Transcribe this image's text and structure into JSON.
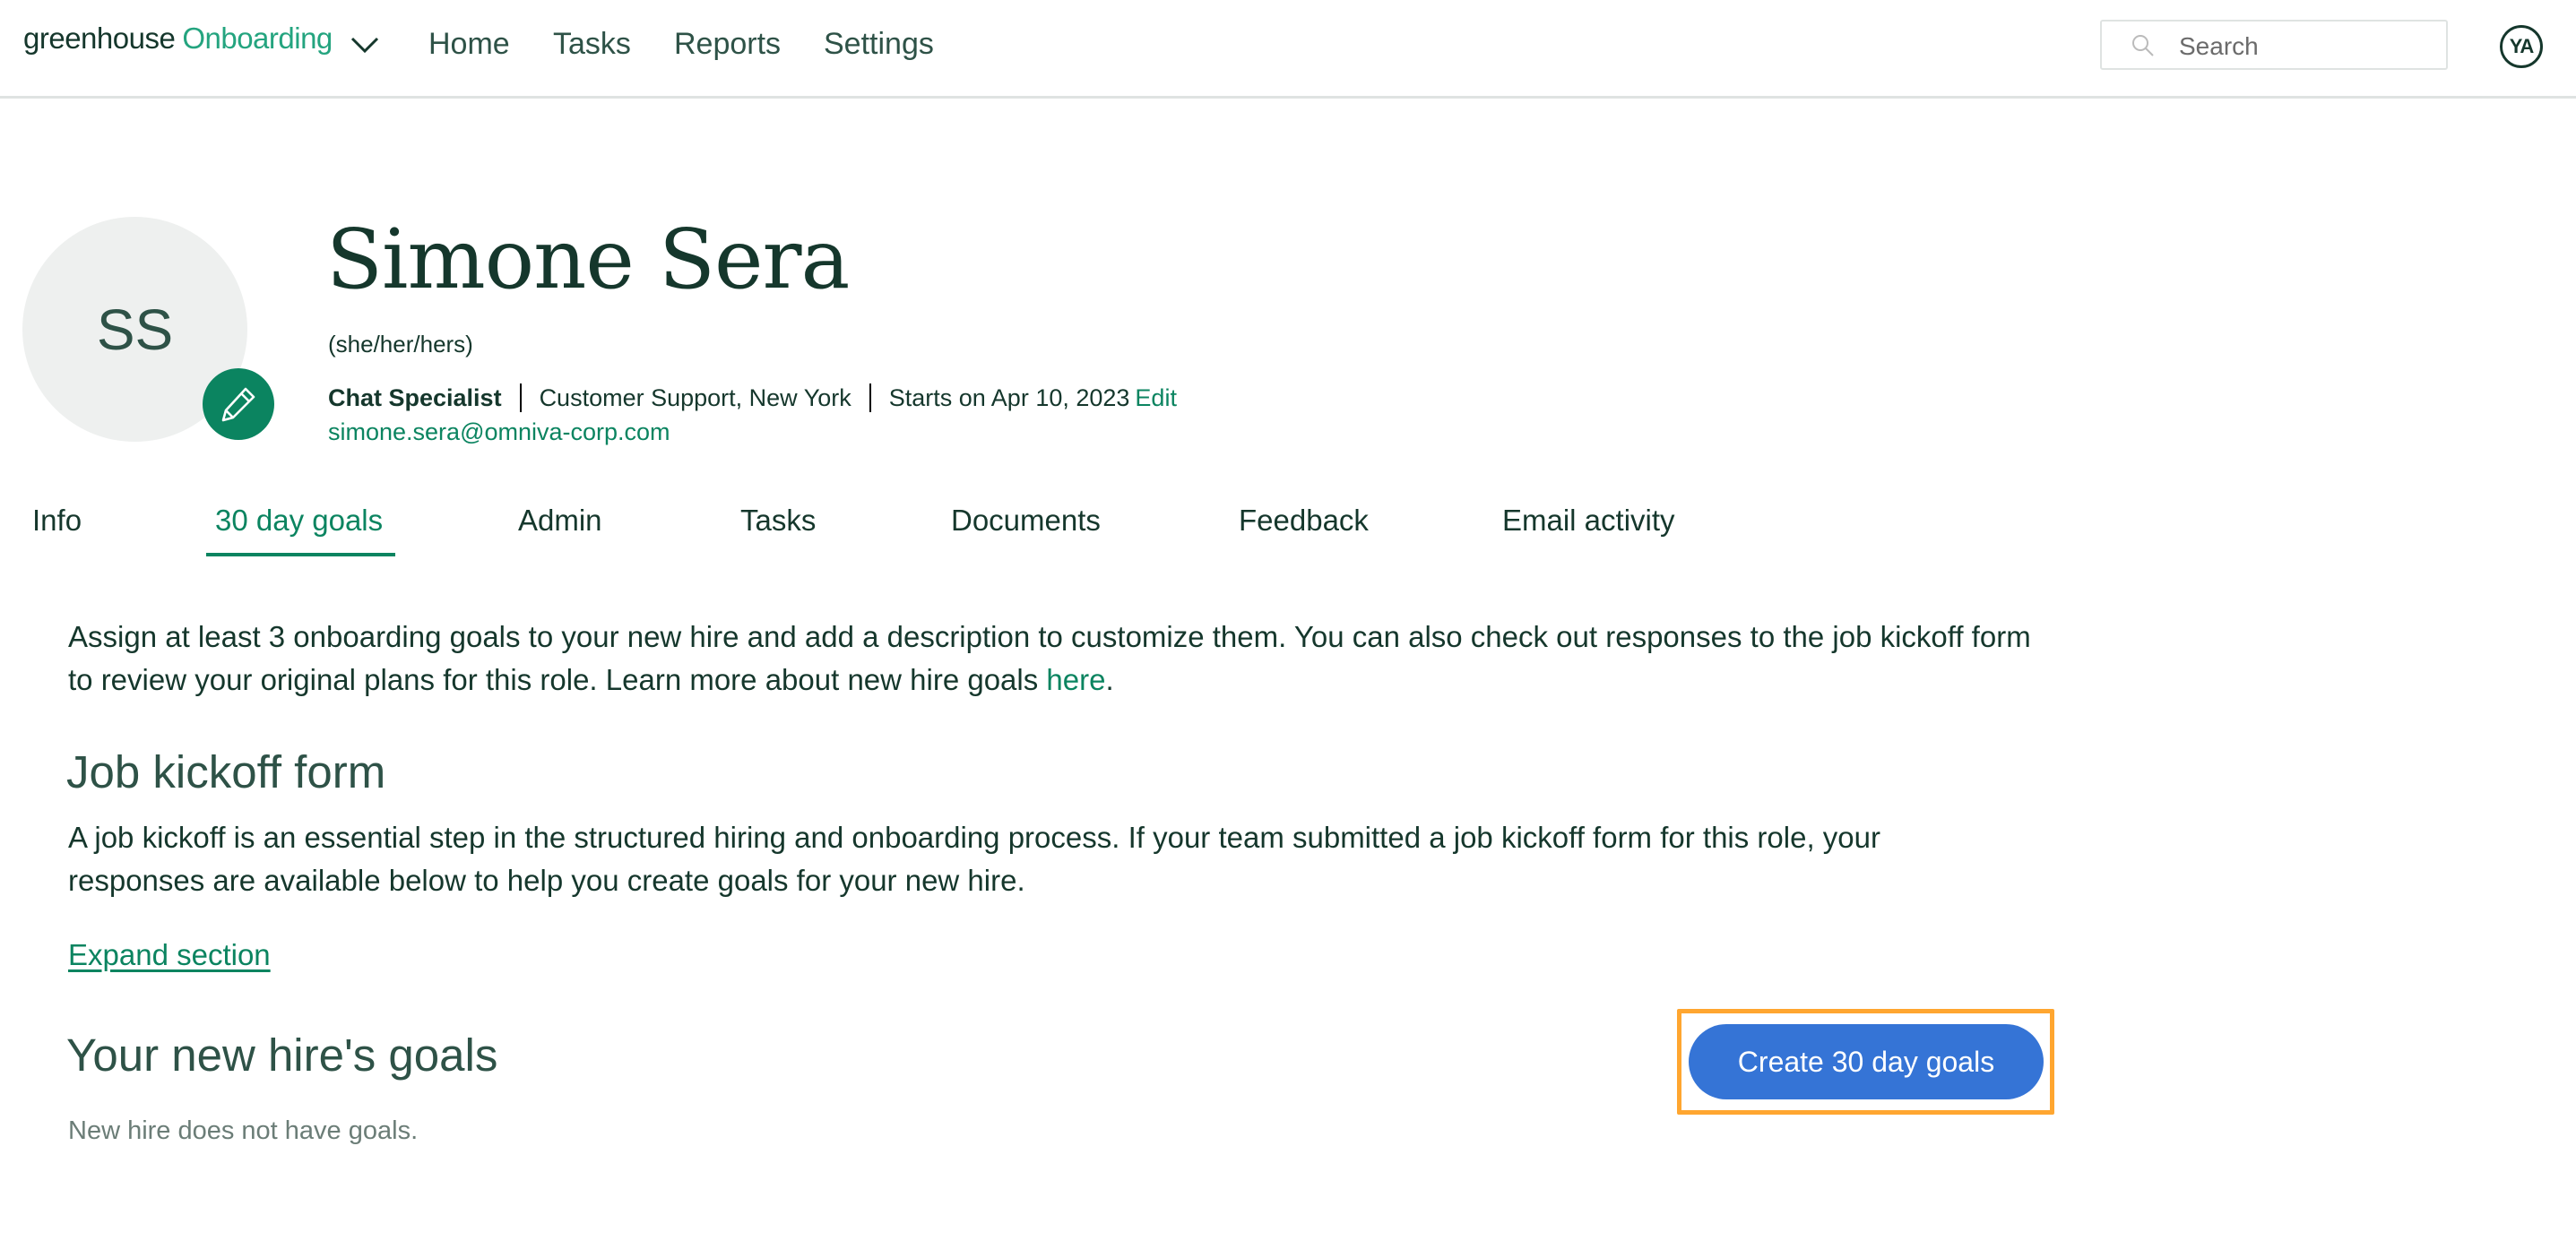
{
  "header": {
    "logo_brand": "greenhouse",
    "logo_product": "Onboarding",
    "nav": [
      {
        "label": "Home"
      },
      {
        "label": "Tasks"
      },
      {
        "label": "Reports"
      },
      {
        "label": "Settings"
      }
    ],
    "search": {
      "placeholder": "Search",
      "value": ""
    },
    "user_initials": "YA"
  },
  "profile": {
    "initials": "SS",
    "name": "Simone Sera",
    "pronouns": "(she/her/hers)",
    "job_title": "Chat Specialist",
    "department_location": "Customer Support, New York",
    "start_date": "Starts on Apr 10, 2023",
    "edit_label": "Edit",
    "email": "simone.sera@omniva-corp.com"
  },
  "tabs": [
    {
      "label": "Info",
      "active": false
    },
    {
      "label": "30 day goals",
      "active": true
    },
    {
      "label": "Admin",
      "active": false
    },
    {
      "label": "Tasks",
      "active": false
    },
    {
      "label": "Documents",
      "active": false
    },
    {
      "label": "Feedback",
      "active": false
    },
    {
      "label": "Email activity",
      "active": false
    }
  ],
  "goals_page": {
    "intro_text": "Assign at least 3 onboarding goals to your new hire and add a description to customize them. You can also check out responses to the job kickoff form to review your original plans for this role. Learn more about new hire goals ",
    "intro_link": "here",
    "intro_end": ".",
    "kickoff": {
      "heading": "Job kickoff form",
      "description": "A job kickoff is an essential step in the structured hiring and onboarding process. If your team submitted a job kickoff form for this role, your responses are available below to help you create goals for your new hire.",
      "expand_label": "Expand section"
    },
    "goals": {
      "heading": "Your new hire's goals",
      "empty_text": "New hire does not have goals.",
      "create_button": "Create 30 day goals"
    }
  },
  "colors": {
    "brand_green": "#0b8460",
    "logo_green": "#24a47f",
    "text_dark": "#15372c",
    "primary_button": "#3574d6",
    "highlight_outline": "#ffa630"
  }
}
